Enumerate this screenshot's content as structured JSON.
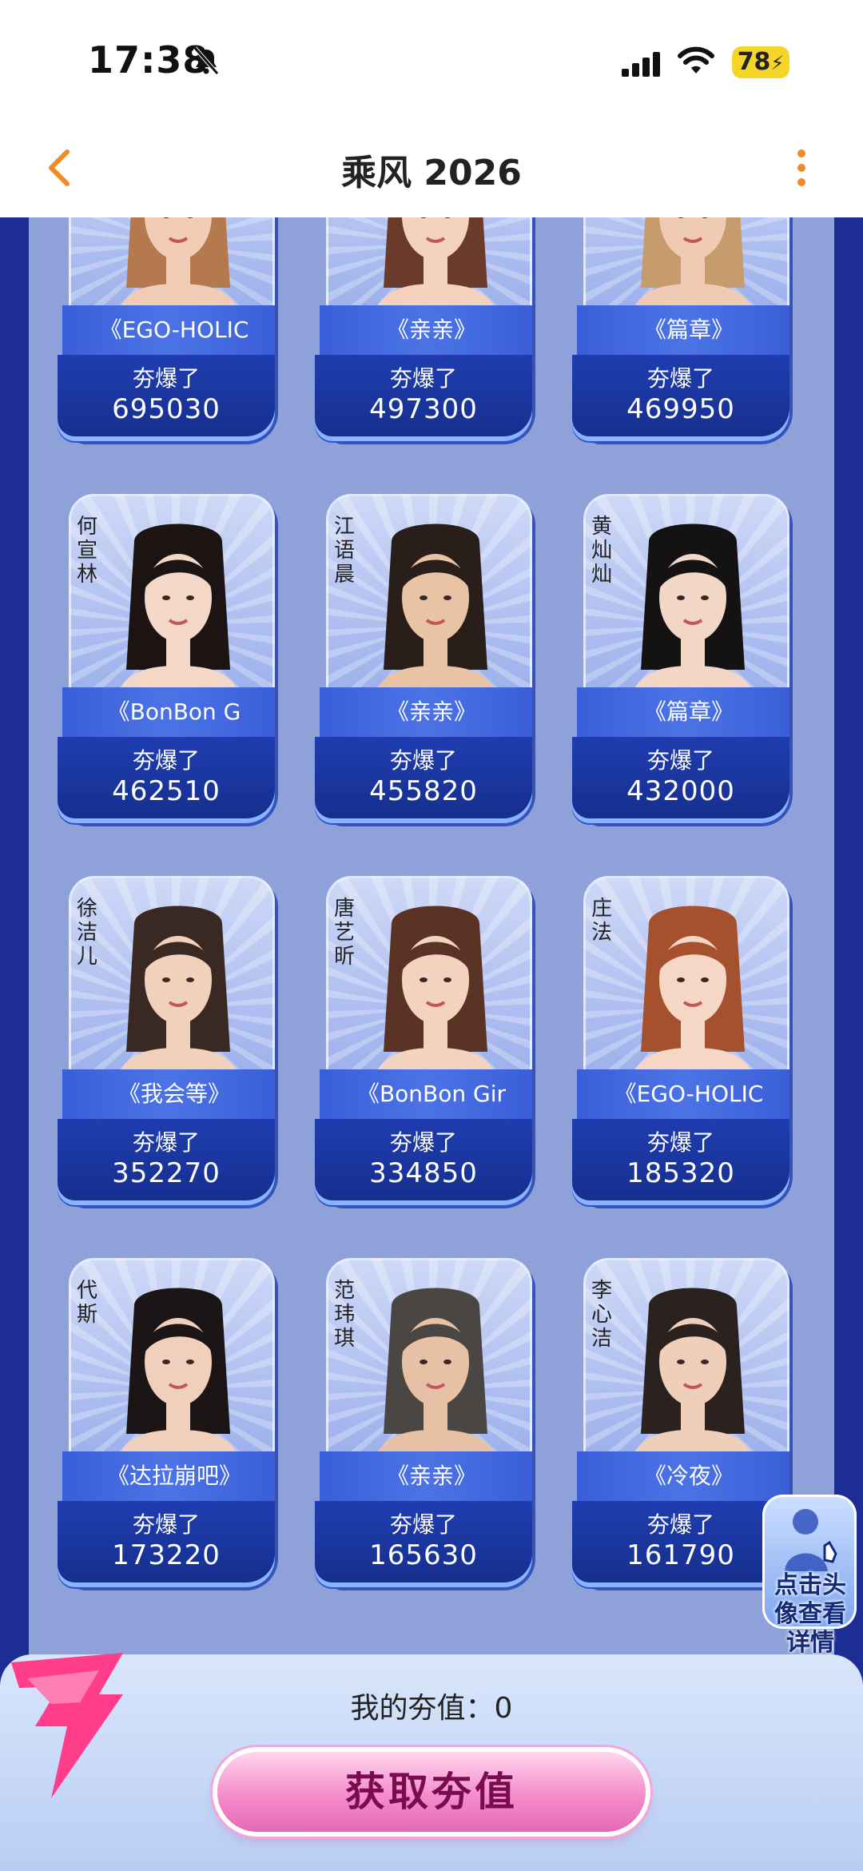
{
  "status_bar": {
    "time": "17:38",
    "battery": "78"
  },
  "nav": {
    "title": "乘风 2026"
  },
  "cards": [
    {
      "name": "",
      "song": "《EGO-HOLIC",
      "label": "夯爆了",
      "score": "695030",
      "colors": {
        "hair": "#b47a4e",
        "skin": "#f1cdb5",
        "cloth": "#ffffff",
        "bg": "#e8eefc"
      }
    },
    {
      "name": "",
      "song": "《亲亲》",
      "label": "夯爆了",
      "score": "497300",
      "colors": {
        "hair": "#6a3b2a",
        "skin": "#f3d2bf",
        "cloth": "#fbf6ef",
        "bg": "#e8eefc"
      }
    },
    {
      "name": "",
      "song": "《篇章》",
      "label": "夯爆了",
      "score": "469950",
      "colors": {
        "hair": "#c69c6d",
        "skin": "#f0cbb3",
        "cloth": "#8e3a2a",
        "bg": "#e8eefc"
      }
    },
    {
      "name": "何宣林",
      "song": "《BonBon G",
      "label": "夯爆了",
      "score": "462510",
      "colors": {
        "hair": "#1b1413",
        "skin": "#f3d8c8",
        "cloth": "#b08d66",
        "bg": "#e8eefc"
      }
    },
    {
      "name": "江语晨",
      "song": "《亲亲》",
      "label": "夯爆了",
      "score": "455820",
      "colors": {
        "hair": "#2a1e1a",
        "skin": "#e8c3a6",
        "cloth": "#f7f4ef",
        "bg": "#e8eefc"
      }
    },
    {
      "name": "黄灿灿",
      "song": "《篇章》",
      "label": "夯爆了",
      "score": "432000",
      "colors": {
        "hair": "#151214",
        "skin": "#f2d6c6",
        "cloth": "#fafafa",
        "bg": "#e8eefc"
      }
    },
    {
      "name": "徐洁儿",
      "song": "《我会等》",
      "label": "夯爆了",
      "score": "352270",
      "colors": {
        "hair": "#3a2822",
        "skin": "#f1d1bc",
        "cloth": "#151515",
        "bg": "#e8eefc"
      }
    },
    {
      "name": "唐艺昕",
      "song": "《BonBon Gir",
      "label": "夯爆了",
      "score": "334850",
      "colors": {
        "hair": "#5a3324",
        "skin": "#f3d3c0",
        "cloth": "#ffffff",
        "bg": "#e8eefc"
      }
    },
    {
      "name": "庄法",
      "song": "《EGO-HOLIC",
      "label": "夯爆了",
      "score": "185320",
      "colors": {
        "hair": "#a5512e",
        "skin": "#f6d6c5",
        "cloth": "#1a1a1a",
        "bg": "#e8eefc"
      }
    },
    {
      "name": "代斯",
      "song": "《达拉崩吧》",
      "label": "夯爆了",
      "score": "173220",
      "colors": {
        "hair": "#1c1515",
        "skin": "#f0d0bd",
        "cloth": "#2a2a2a",
        "bg": "#e8eefc"
      }
    },
    {
      "name": "范玮琪",
      "song": "《亲亲》",
      "label": "夯爆了",
      "score": "165630",
      "colors": {
        "hair": "#4a4644",
        "skin": "#e7c1a5",
        "cloth": "#f4f2ef",
        "bg": "#e8eefc"
      }
    },
    {
      "name": "李心洁",
      "song": "《冷夜》",
      "label": "夯爆了",
      "score": "161790",
      "colors": {
        "hair": "#2b2220",
        "skin": "#f0cfba",
        "cloth": "#ffffff",
        "bg": "#e8eefc"
      }
    }
  ],
  "hint": {
    "text": "点击头像查看详情"
  },
  "bottom": {
    "my_value_label": "我的夯值：0",
    "button_label": "获取夯值"
  },
  "theme": {
    "accent": "#f08a24",
    "page_bg": "#8ea1d8",
    "side_bg": "#1c2e94",
    "card_dark": "#162f8e"
  }
}
